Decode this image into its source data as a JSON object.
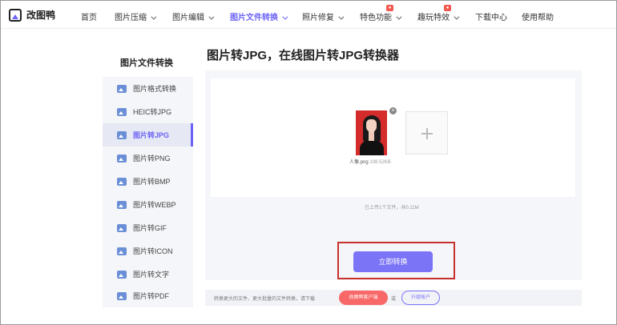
{
  "header": {
    "brand": "改图鸭",
    "nav": [
      {
        "label": "首页",
        "dropdown": false,
        "active": false,
        "badge": false
      },
      {
        "label": "图片压缩",
        "dropdown": true,
        "active": false,
        "badge": false
      },
      {
        "label": "图片编辑",
        "dropdown": true,
        "active": false,
        "badge": false
      },
      {
        "label": "图片文件转换",
        "dropdown": true,
        "active": true,
        "badge": false
      },
      {
        "label": "照片修复",
        "dropdown": true,
        "active": false,
        "badge": false
      },
      {
        "label": "特色功能",
        "dropdown": true,
        "active": false,
        "badge": true
      },
      {
        "label": "趣玩特效",
        "dropdown": true,
        "active": false,
        "badge": true
      },
      {
        "label": "下载中心",
        "dropdown": false,
        "active": false,
        "badge": false
      },
      {
        "label": "使用帮助",
        "dropdown": false,
        "active": false,
        "badge": false
      }
    ]
  },
  "sidebar": {
    "title": "图片文件转换",
    "items": [
      {
        "label": "图片格式转换",
        "active": false
      },
      {
        "label": "HEIC转JPG",
        "active": false
      },
      {
        "label": "图片转JPG",
        "active": true
      },
      {
        "label": "图片转PNG",
        "active": false
      },
      {
        "label": "图片转BMP",
        "active": false
      },
      {
        "label": "图片转WEBP",
        "active": false
      },
      {
        "label": "图片转GIF",
        "active": false
      },
      {
        "label": "图片转ICON",
        "active": false
      },
      {
        "label": "图片转文字",
        "active": false
      },
      {
        "label": "图片转PDF",
        "active": false
      }
    ]
  },
  "main": {
    "title": "图片转JPG，在线图片转JPG转换器",
    "file": {
      "name": "人像.png",
      "size": "108.52KB"
    },
    "upload_info": "已上传1个文件，共0.11M",
    "convert_label": "立即转换",
    "bottom": {
      "text": "转换更大的文件、更大批量的文件转换，请下载",
      "client_label": "改图鸭客户端",
      "or_text": "或",
      "upgrade_label": "升级账户"
    }
  },
  "colors": {
    "accent": "#6c63f6",
    "button": "#7b74f6",
    "highlight": "#c8312b",
    "client": "#f86868"
  }
}
